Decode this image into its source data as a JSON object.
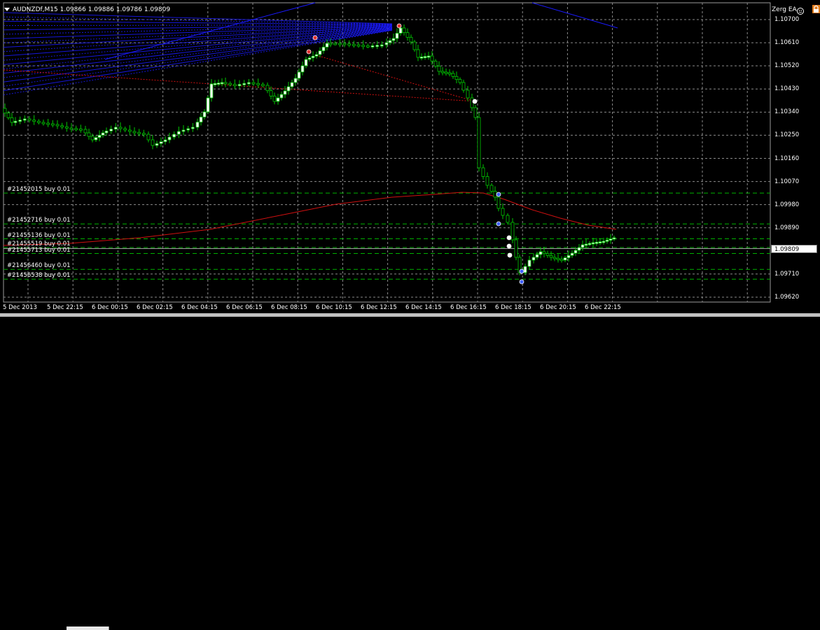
{
  "header": {
    "symbol_info": "AUDNZDf,M15  1.09866 1.09886 1.09786 1.09809",
    "expert_name": "Zerg EA"
  },
  "orders": [
    {
      "label": "#21452015 buy 0.01",
      "price": 1.10025
    },
    {
      "label": "#21452716 buy 0.01",
      "price": 1.09905
    },
    {
      "label": "#21455136 buy 0.01",
      "price": 1.09847
    },
    {
      "label": "#21455519 buy 0.01",
      "price": 1.09813
    },
    {
      "label": "#21455713 buy 0.01",
      "price": 1.0979
    },
    {
      "label": "#21456460 buy 0.01",
      "price": 1.09728
    },
    {
      "label": "#21456538 buy 0.01",
      "price": 1.0969
    }
  ],
  "price_axis": [
    "1.10700",
    "1.10610",
    "1.10520",
    "1.10430",
    "1.10340",
    "1.10250",
    "1.10160",
    "1.10070",
    "1.09980",
    "1.09890",
    "1.09809",
    "1.09710",
    "1.09620"
  ],
  "current_price": "1.09809",
  "time_axis": [
    "5 Dec 2013",
    "5 Dec 22:15",
    "6 Dec 00:15",
    "6 Dec 02:15",
    "6 Dec 04:15",
    "6 Dec 06:15",
    "6 Dec 08:15",
    "6 Dec 10:15",
    "6 Dec 12:15",
    "6 Dec 14:15",
    "6 Dec 16:15",
    "6 Dec 18:15",
    "6 Dec 20:15",
    "6 Dec 22:15"
  ],
  "colors": {
    "background": "#000000",
    "grid": "#8a8a8a",
    "bull_candle": "#ffffff",
    "candle_outline": "#00c800",
    "order_line": "#00b000",
    "moving_average": "#d01010",
    "fan_lines": "#1a1aff",
    "current_price_line": "#a0a0a0"
  },
  "icons": {
    "menu": "triangle-down-icon",
    "expert": "smiley-icon",
    "lock": "lock-icon"
  }
}
